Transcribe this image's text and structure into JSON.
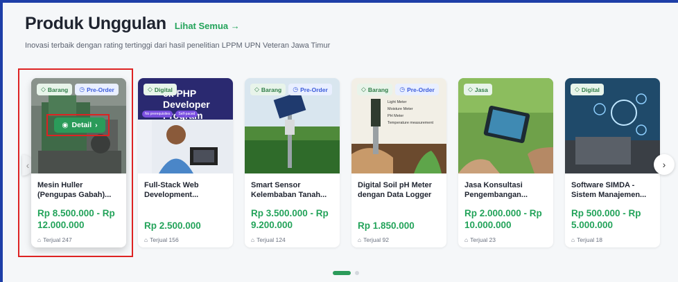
{
  "section": {
    "title": "Produk Unggulan",
    "see_all": "Lihat Semua →",
    "subtitle": "Inovasi terbaik dengan rating tertinggi dari hasil penelitian LPPM UPN Veteran Jawa Timur"
  },
  "products": [
    {
      "type": "Barang",
      "preorder": "Pre-Order",
      "name": "Mesin Huller (Pengupas Gabah)...",
      "price": "Rp 8.500.000 - Rp 12.000.000",
      "sold": "Terjual 247",
      "detail_label": "Detail"
    },
    {
      "type": "Digital",
      "preorder": "",
      "banner_line1": "ck PHP",
      "banner_line2": "Developer Program",
      "banner_tags": [
        "No prerequisites",
        "Self-paced"
      ],
      "name": "Full-Stack Web Development...",
      "price": "Rp 2.500.000",
      "sold": "Terjual 156"
    },
    {
      "type": "Barang",
      "preorder": "Pre-Order",
      "name": "Smart Sensor Kelembaban Tanah...",
      "price": "Rp 3.500.000 - Rp 9.200.000",
      "sold": "Terjual 124"
    },
    {
      "type": "Barang",
      "preorder": "Pre-Order",
      "meter_labels": [
        "Light Meter",
        "Moisture Meter",
        "PH Meter",
        "Temperature measurement"
      ],
      "name": "Digital Soil pH Meter dengan Data Logger",
      "price": "Rp 1.850.000",
      "sold": "Terjual 92"
    },
    {
      "type": "Jasa",
      "preorder": "",
      "name": "Jasa Konsultasi Pengembangan...",
      "price": "Rp 2.000.000 - Rp 10.000.000",
      "sold": "Terjual 23"
    },
    {
      "type": "Digital",
      "preorder": "",
      "name": "Software SIMDA - Sistem Manajemen...",
      "price": "Rp 500.000 - Rp 5.000.000",
      "sold": "Terjual 18"
    }
  ],
  "carousel": {
    "next": "›",
    "prev": "‹",
    "active_page": 1,
    "pages": 2
  },
  "colors": {
    "accent": "#2b9b5a",
    "brand_blue": "#1e3fa8",
    "highlight": "#dd2222"
  }
}
